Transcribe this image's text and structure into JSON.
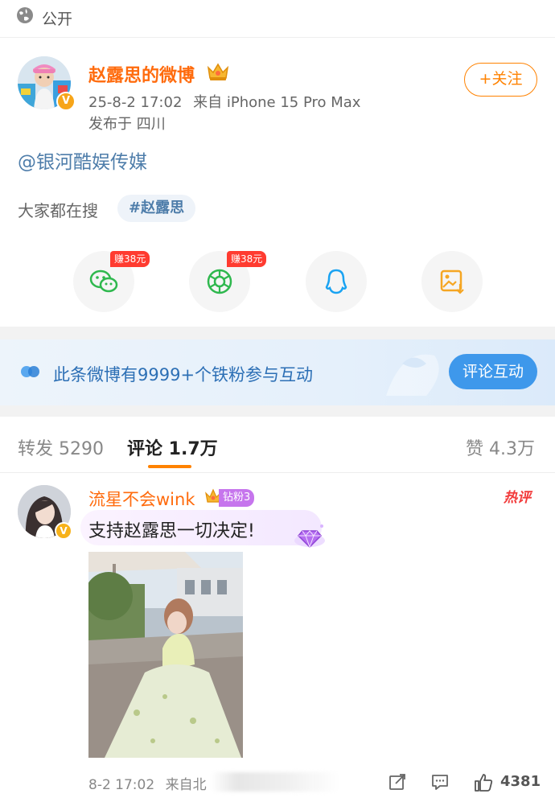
{
  "topbar": {
    "visibility": "公开",
    "icon": "globe-icon"
  },
  "post": {
    "author": "赵露思的微博",
    "datetime": "25-8-2 17:02",
    "source": "来自 iPhone 15 Pro Max",
    "location": "发布于 四川",
    "follow_label": "+关注",
    "mention": "@银河酷娱传媒",
    "search_label": "大家都在搜",
    "search_tag": "#赵露思"
  },
  "share": [
    {
      "icon": "wechat-icon",
      "badge": "赚38元",
      "color": "#2fb84e"
    },
    {
      "icon": "moments-icon",
      "badge": "赚38元",
      "color": "#2fb84e"
    },
    {
      "icon": "qq-icon",
      "badge": "",
      "color": "#1aa3f2"
    },
    {
      "icon": "save-image-icon",
      "badge": "",
      "color": "#f5a623"
    }
  ],
  "fans_banner": {
    "text": "此条微博有9999+个铁粉参与互动",
    "button": "评论互动"
  },
  "tabs": {
    "repost": "转发 5290",
    "comments": "评论 1.7万",
    "likes": "赞 4.3万",
    "active": "comments"
  },
  "comment": {
    "user": "流星不会wink",
    "fan_badge": "钻粉3",
    "hot_badge": "热评",
    "text": "支持赵露思一切决定!",
    "time": "8-2 17:02",
    "source": "来自北",
    "like_count": "4381"
  },
  "colors": {
    "accent": "#ff8200",
    "name": "#ff6b0d",
    "link": "#4e7daa",
    "banner_button": "#3e98eb"
  }
}
